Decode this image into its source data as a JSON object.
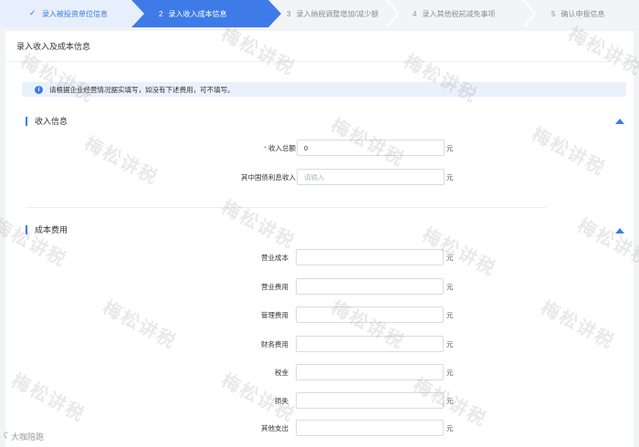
{
  "steps": [
    {
      "num": "",
      "label": "录入被投资单位信息",
      "state": "done"
    },
    {
      "num": "2",
      "label": "录入收入成本信息",
      "state": "active"
    },
    {
      "num": "3",
      "label": "录入纳税调整增加/减少额",
      "state": "pending"
    },
    {
      "num": "4",
      "label": "录入其他税前减免事项",
      "state": "pending"
    },
    {
      "num": "5",
      "label": "确认申报信息",
      "state": "pending"
    }
  ],
  "panel": {
    "title": "录入收入及成本信息",
    "notice": "请根据企业经营情况据实填写，如没有下述费用，可不填写。"
  },
  "income": {
    "title": "收入信息",
    "fields": [
      {
        "label": "收入总额",
        "required": "*",
        "value": "0",
        "placeholder": "",
        "unit": "元"
      },
      {
        "label": "其中国债利息收入",
        "required": "",
        "value": "",
        "placeholder": "请输入",
        "unit": "元"
      }
    ]
  },
  "cost": {
    "title": "成本费用",
    "fields": [
      {
        "label": "营业成本",
        "unit": "元"
      },
      {
        "label": "营业费用",
        "unit": "元"
      },
      {
        "label": "管理费用",
        "unit": "元"
      },
      {
        "label": "财务费用",
        "unit": "元"
      },
      {
        "label": "税金",
        "unit": "元"
      },
      {
        "label": "损失",
        "unit": "元"
      },
      {
        "label": "其他支出",
        "unit": "元"
      }
    ]
  },
  "watermark": "梅松讲税",
  "brand": "大咖陪跑",
  "colors": {
    "accent": "#3e7be8",
    "required": "#e04b4b"
  }
}
